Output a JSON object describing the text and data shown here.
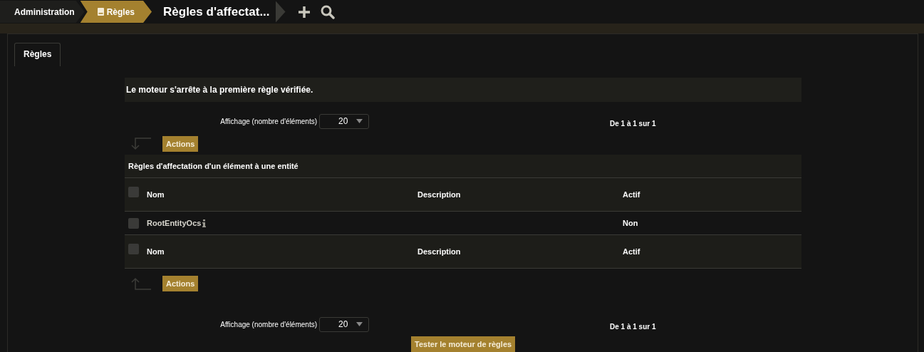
{
  "breadcrumbs": [
    {
      "label": "Administration",
      "selected": false,
      "icon": false
    },
    {
      "label": "Règles",
      "selected": true,
      "icon": true
    }
  ],
  "page_title": "Règles d'affectat...",
  "tabs": [
    {
      "label": "Règles",
      "selected": true
    }
  ],
  "notice": "Le moteur s'arrête à la première règle vérifiée.",
  "pager_top": {
    "label": "Affichage (nombre d'éléments)",
    "value": "20",
    "range": "De 1 à 1 sur 1"
  },
  "actions_top": "Actions",
  "table": {
    "caption": "Règles d'affectation d'un élément à une entité",
    "columns": [
      "Nom",
      "Description",
      "Actif"
    ],
    "select_all_checked": false,
    "footer_select_all_checked": false,
    "rows": [
      {
        "name": "RootEntityOcs",
        "description": "",
        "active": "Non",
        "checked": false,
        "info": true
      }
    ],
    "footer_columns": [
      "Nom",
      "Description",
      "Actif"
    ]
  },
  "actions_bottom": "Actions",
  "pager_bottom": {
    "label": "Affichage (nombre d'éléments)",
    "value": "20",
    "range": "De 1 à 1 sur 1"
  },
  "test_button": "Tester le moteur de règles"
}
